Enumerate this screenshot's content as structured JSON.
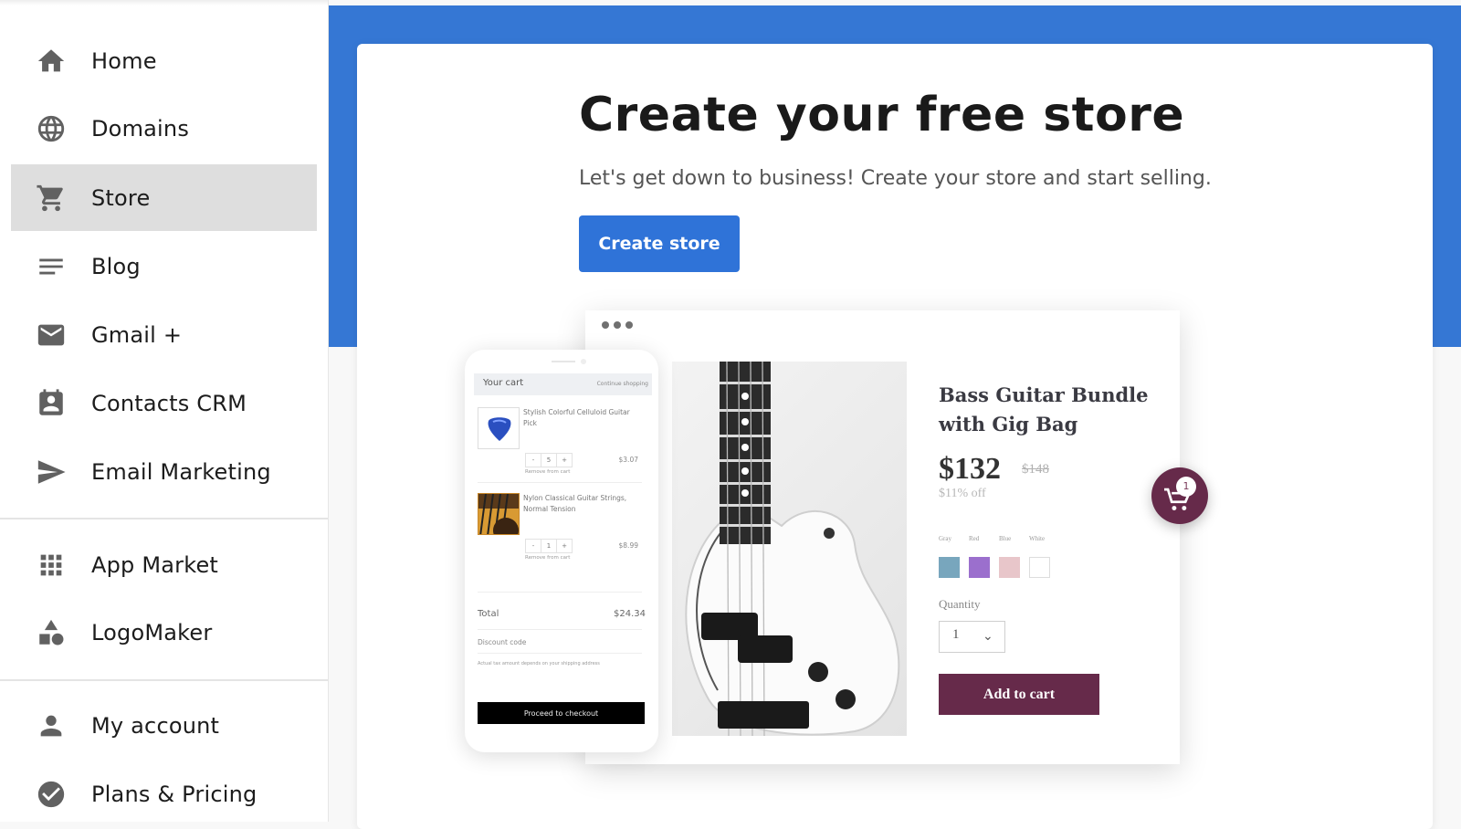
{
  "sidebar": {
    "groups": [
      [
        {
          "label": "Home",
          "icon": "home-icon"
        },
        {
          "label": "Domains",
          "icon": "globe-icon"
        },
        {
          "label": "Store",
          "icon": "cart-icon",
          "active": true
        },
        {
          "label": "Blog",
          "icon": "lines-icon"
        },
        {
          "label": "Gmail +",
          "icon": "mail-icon"
        },
        {
          "label": "Contacts CRM",
          "icon": "contact-card-icon"
        },
        {
          "label": "Email Marketing",
          "icon": "send-icon"
        }
      ],
      [
        {
          "label": "App Market",
          "icon": "apps-grid-icon"
        },
        {
          "label": "LogoMaker",
          "icon": "shapes-icon"
        }
      ],
      [
        {
          "label": "My account",
          "icon": "person-icon"
        },
        {
          "label": "Plans & Pricing",
          "icon": "check-circle-icon"
        }
      ]
    ],
    "items": {
      "home": "Home",
      "domains": "Domains",
      "store": "Store",
      "blog": "Blog",
      "gmail": "Gmail +",
      "contacts": "Contacts CRM",
      "email_marketing": "Email Marketing",
      "app_market": "App Market",
      "logomaker": "LogoMaker",
      "my_account": "My account",
      "plans": "Plans & Pricing"
    },
    "active_item": "Store"
  },
  "hero": {
    "title": "Create your free store",
    "subtitle": "Let's get down to business! Create your store and start selling.",
    "cta_label": "Create store"
  },
  "colors": {
    "brand_blue": "#3577d4",
    "button_blue": "#2f73d8",
    "store_accent": "#662a4a",
    "active_bg": "#dedede",
    "icon_gray": "#616161"
  },
  "product_preview": {
    "title": "Bass Guitar Bundle with Gig Bag",
    "price": "$132",
    "old_price": "$148",
    "discount": "$11% off",
    "color_options": [
      {
        "label": "Gray",
        "hex": "#78a6bd"
      },
      {
        "label": "Red",
        "hex": "#9b6fcd"
      },
      {
        "label": "Blue",
        "hex": "#e8c6ca"
      },
      {
        "label": "White",
        "hex": "#ffffff"
      }
    ],
    "quantity_label": "Quantity",
    "quantity_value": "1",
    "add_to_cart_label": "Add to cart",
    "cart_count": "1"
  },
  "cart_preview": {
    "title": "Your cart",
    "continue_label": "Continue shopping",
    "items": [
      {
        "name": "Stylish Colorful Celluloid Guitar Pick",
        "qty": "5",
        "price": "$3.07",
        "remove_label": "Remove from cart"
      },
      {
        "name": "Nylon Classical Guitar Strings, Normal Tension",
        "qty": "1",
        "price": "$8.99",
        "remove_label": "Remove from cart"
      }
    ],
    "minus": "-",
    "plus": "+",
    "total_label": "Total",
    "total_value": "$24.34",
    "discount_label": "Discount code",
    "tax_note": "Actual tax amount depends on your shipping address",
    "checkout_label": "Proceed to checkout"
  }
}
